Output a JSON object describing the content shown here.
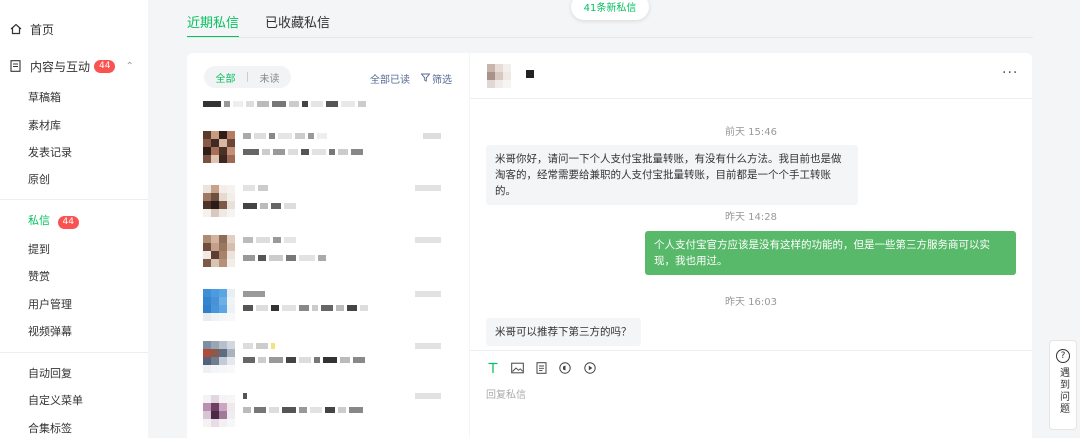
{
  "sidebar": {
    "home": "首页",
    "content": {
      "label": "内容与互动",
      "badge": "44"
    },
    "items": [
      "草稿箱",
      "素材库",
      "发表记录",
      "原创"
    ],
    "messages": {
      "label": "私信",
      "badge": "44"
    },
    "items2": [
      "提到",
      "赞赏",
      "用户管理",
      "视频弹幕"
    ],
    "items3": [
      "自动回复",
      "自定义菜单",
      "合集标签"
    ]
  },
  "tabs": [
    "近期私信",
    "已收藏私信"
  ],
  "new_messages": "41条新私信",
  "list": {
    "seg_all": "全部",
    "seg_unread": "未读",
    "mark_all_read": "全部已读",
    "filter": "筛选"
  },
  "conversation": {
    "messages": [
      {
        "time": "前天 15:46",
        "direction": "in",
        "text": "米哥你好，请问一下个人支付宝批量转账，有没有什么方法。我目前也是做淘客的，经常需要给兼职的人支付宝批量转账，目前都是一个个手工转账的。"
      },
      {
        "time": "昨天 14:28",
        "direction": "out",
        "text": "个人支付宝官方应该是没有这样的功能的，但是一些第三方服务商可以实现，我也用过。"
      },
      {
        "time": "昨天 16:03",
        "direction": "in",
        "text": "米哥可以推荐下第三方的吗？"
      }
    ],
    "reply_placeholder": "回复私信",
    "more": "···"
  },
  "help": {
    "icon": "?",
    "label": "遇到问题"
  },
  "colors": {
    "accent": "#07c160",
    "out_bubble": "#59b96a",
    "badge": "#fa5151"
  }
}
